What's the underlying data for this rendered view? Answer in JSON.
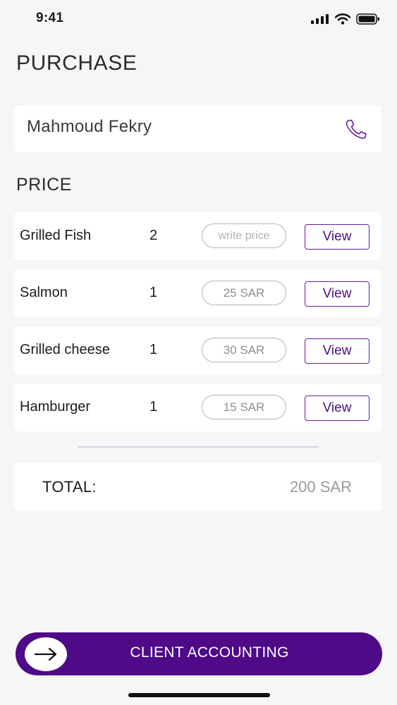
{
  "status_bar": {
    "time": "9:41"
  },
  "header": {
    "title": "PURCHASE"
  },
  "client": {
    "name": "Mahmoud Fekry"
  },
  "price_section": {
    "title": "PRICE",
    "items": [
      {
        "name": "Grilled Fish",
        "quantity": "2",
        "price": "",
        "price_placeholder": "write price",
        "view_label": "View"
      },
      {
        "name": "Salmon",
        "quantity": "1",
        "price": "25 SAR",
        "price_placeholder": "",
        "view_label": "View"
      },
      {
        "name": "Grilled cheese",
        "quantity": "1",
        "price": "30 SAR",
        "price_placeholder": "",
        "view_label": "View"
      },
      {
        "name": "Hamburger",
        "quantity": "1",
        "price": "15 SAR",
        "price_placeholder": "",
        "view_label": "View"
      }
    ]
  },
  "total": {
    "label": "TOTAL:",
    "value": "200 SAR"
  },
  "cta": {
    "label": "CLIENT ACCOUNTING"
  },
  "colors": {
    "accent": "#4f0a88",
    "background": "#f6f6f9",
    "card": "#ffffff"
  }
}
